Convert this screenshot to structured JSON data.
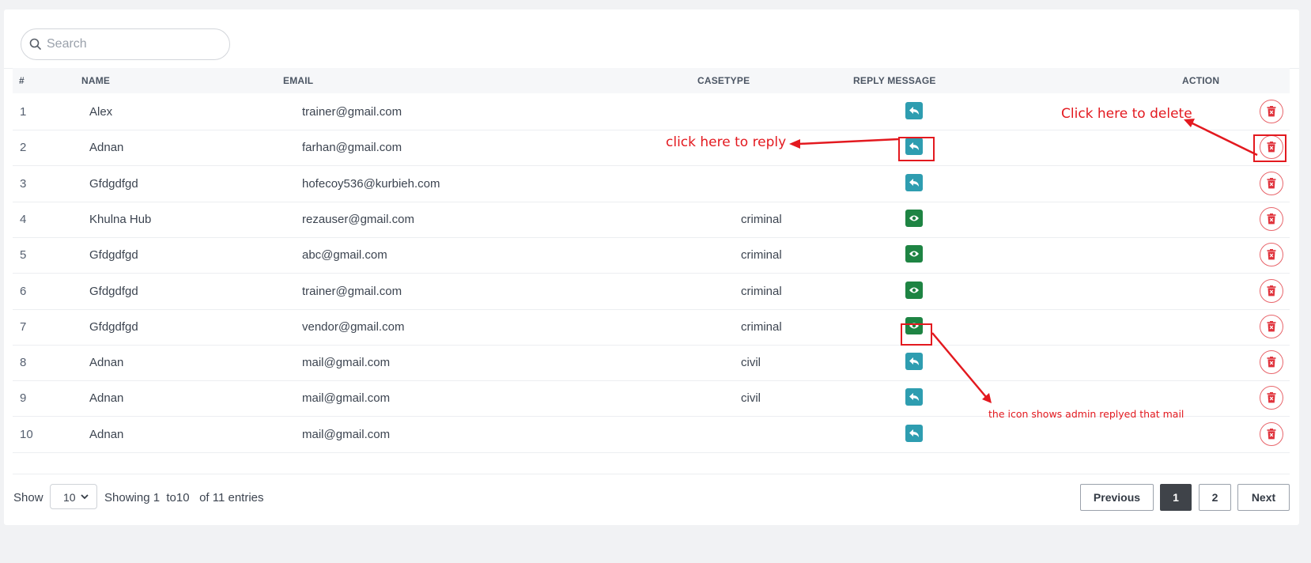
{
  "search": {
    "placeholder": "Search",
    "value": ""
  },
  "table": {
    "headers": {
      "index": "#",
      "name": "NAME",
      "email": "EMAIL",
      "casetype": "CASETYPE",
      "reply": "REPLY MESSAGE",
      "action": "ACTION"
    },
    "rows": [
      {
        "index": "1",
        "name": "Alex",
        "email": "trainer@gmail.com",
        "casetype": "",
        "reply_icon": "reply-icon"
      },
      {
        "index": "2",
        "name": "Adnan",
        "email": "farhan@gmail.com",
        "casetype": "",
        "reply_icon": "reply-icon"
      },
      {
        "index": "3",
        "name": "Gfdgdfgd",
        "email": "hofecoy536@kurbieh.com",
        "casetype": "",
        "reply_icon": "reply-icon"
      },
      {
        "index": "4",
        "name": "Khulna Hub",
        "email": "rezauser@gmail.com",
        "casetype": "criminal",
        "reply_icon": "eye-icon"
      },
      {
        "index": "5",
        "name": "Gfdgdfgd",
        "email": "abc@gmail.com",
        "casetype": "criminal",
        "reply_icon": "eye-icon"
      },
      {
        "index": "6",
        "name": "Gfdgdfgd",
        "email": "trainer@gmail.com",
        "casetype": "criminal",
        "reply_icon": "eye-icon"
      },
      {
        "index": "7",
        "name": "Gfdgdfgd",
        "email": "vendor@gmail.com",
        "casetype": "criminal",
        "reply_icon": "eye-icon"
      },
      {
        "index": "8",
        "name": "Adnan",
        "email": "mail@gmail.com",
        "casetype": "civil",
        "reply_icon": "reply-icon"
      },
      {
        "index": "9",
        "name": "Adnan",
        "email": "mail@gmail.com",
        "casetype": "civil",
        "reply_icon": "reply-icon"
      },
      {
        "index": "10",
        "name": "Adnan",
        "email": "mail@gmail.com",
        "casetype": "",
        "reply_icon": "reply-icon"
      }
    ]
  },
  "footer": {
    "show_label": "Show",
    "page_size": "10",
    "entries_text": "Showing 1  to10   of 11 entries",
    "pagination": {
      "previous": "Previous",
      "pages": [
        "1",
        "2"
      ],
      "active_page": "1",
      "next": "Next"
    }
  },
  "annotations": {
    "reply_hint": "click here to reply",
    "delete_hint": "Click here to delete",
    "replied_hint": "the icon shows admin replyed that mail"
  },
  "colors": {
    "reply_button": "#2e9db0",
    "view_button": "#1e8443",
    "delete_icon": "#e0343d",
    "annotation": "#e3191f",
    "active_page": "#3f4349"
  }
}
